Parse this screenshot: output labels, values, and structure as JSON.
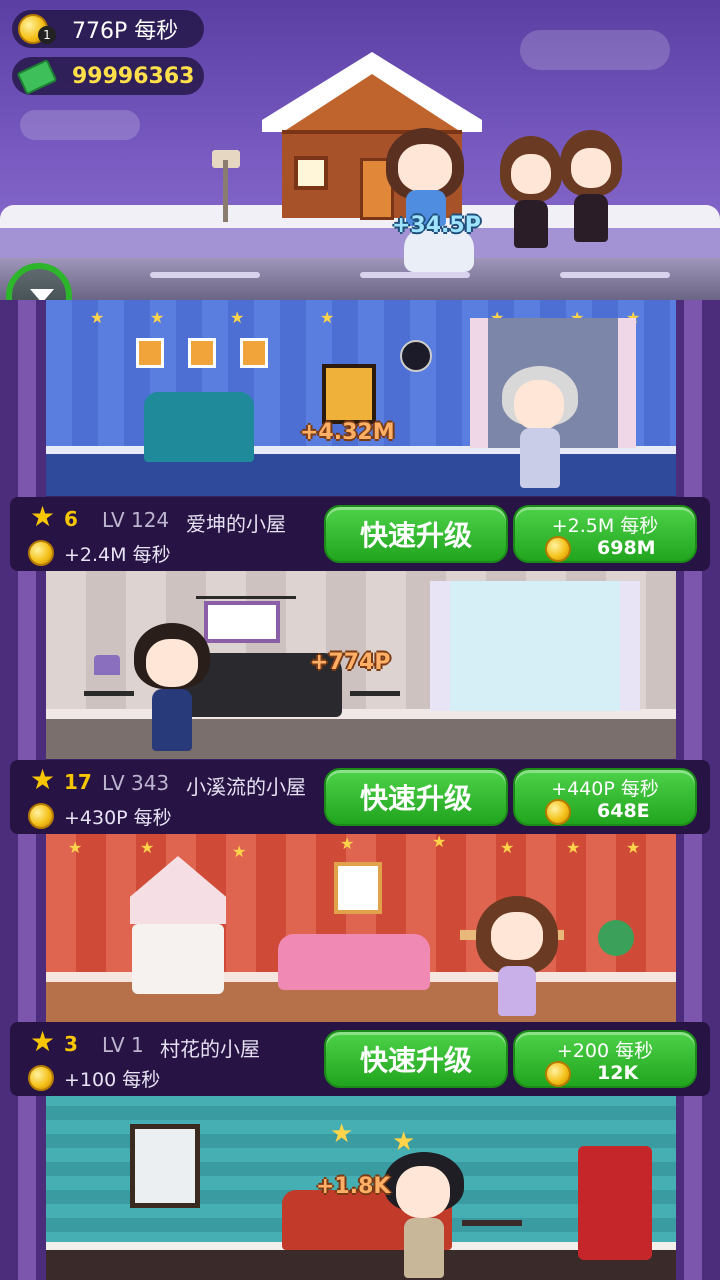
{
  "hud": {
    "income_rate": "776P 每秒",
    "cash": "99996363",
    "roof_bonus": "+34.5P"
  },
  "floors": [
    {
      "stars": "6",
      "level": "LV 124",
      "name": "爱坤的小屋",
      "rate": "+2.4M 每秒",
      "upgrade_label": "快速升级",
      "buy_rate": "+2.5M 每秒",
      "buy_cost": "698M",
      "floating_income": "+4.32M"
    },
    {
      "stars": "17",
      "level": "LV 343",
      "name": "小溪流的小屋",
      "rate": "+430P 每秒",
      "upgrade_label": "快速升级",
      "buy_rate": "+440P 每秒",
      "buy_cost": "648E",
      "floating_income": "+774P"
    },
    {
      "stars": "3",
      "level": "LV 1",
      "name": "村花的小屋",
      "rate": "+100 每秒",
      "upgrade_label": "快速升级",
      "buy_rate": "+200 每秒",
      "buy_cost": "12K",
      "floating_income": ""
    }
  ],
  "bottom_room": {
    "floating_income": "+1.8K"
  },
  "colors": {
    "button_green": "#22a51e",
    "star_gold": "#f7c600",
    "float_orange": "#ffb066",
    "float_blue": "#9fe3ff",
    "panel_dark": "#271444"
  },
  "icons": {
    "coin": "coin-icon",
    "cash": "cash-icon",
    "star": "star-icon",
    "collapse": "chevron-down-icon"
  }
}
